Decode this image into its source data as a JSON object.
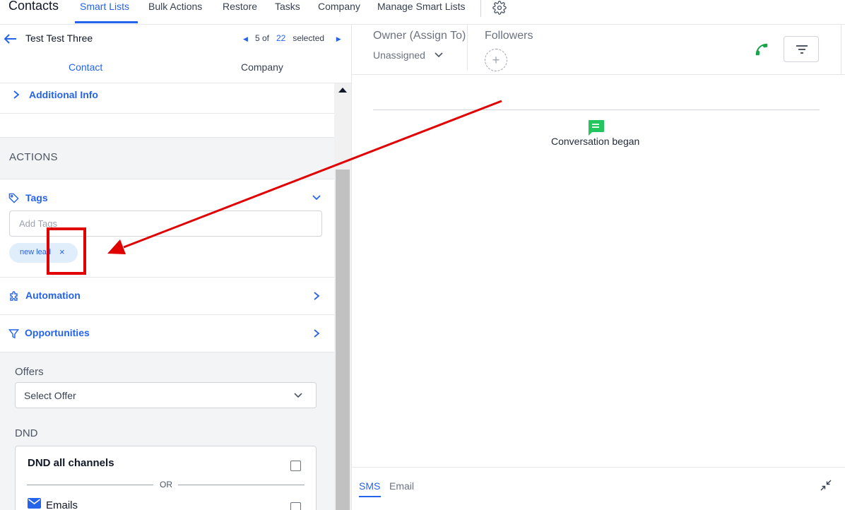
{
  "nav": {
    "app_title": "Contacts",
    "items": [
      "Smart Lists",
      "Bulk Actions",
      "Restore",
      "Tasks",
      "Company",
      "Manage Smart Lists"
    ],
    "active_item": "Smart Lists"
  },
  "contact": {
    "name": "Test Test Three",
    "pager": {
      "current": "5 of",
      "total": "22",
      "suffix": "selected"
    }
  },
  "subtabs": [
    "Contact",
    "Company"
  ],
  "sections": {
    "additional_info": "Additional Info",
    "actions_title": "ACTIONS",
    "tags": {
      "label": "Tags",
      "placeholder": "Add Tags",
      "chips": [
        {
          "label": "new lead",
          "remove": "×"
        }
      ]
    },
    "automation": "Automation",
    "opportunities": "Opportunities",
    "offers": {
      "label": "Offers",
      "select_value": "Select Offer"
    },
    "dnd": {
      "label": "DND",
      "all_channels": "DND all channels",
      "or": "OR",
      "emails": "Emails"
    }
  },
  "right": {
    "owner_label": "Owner (Assign To)",
    "owner_value": "Unassigned",
    "followers_label": "Followers",
    "add_follower": "+",
    "conversation_began": "Conversation began",
    "composer_tabs": [
      "SMS",
      "Email"
    ]
  },
  "colors": {
    "accent": "#2563eb",
    "phone": "#16a34a",
    "conversation_icon": "#22c55e",
    "annotation": "#e00000"
  },
  "icons": {
    "settings": "gear-icon",
    "back": "arrow-left-icon",
    "tags": "tag-icon",
    "automation": "puzzle-icon",
    "opportunities": "funnel-icon",
    "call": "phone-icon",
    "filter": "filter-lines-icon",
    "conversation": "chat-bubble-icon",
    "collapse": "collapse-icon"
  }
}
